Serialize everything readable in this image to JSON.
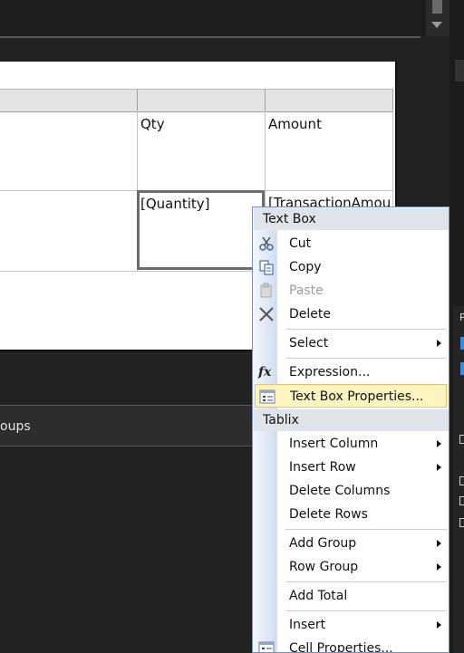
{
  "surface": {
    "header_qty": "Qty",
    "header_amount": "Amount",
    "cell_quantity": "[Quantity]",
    "cell_amount": "[TransactionAmou"
  },
  "groups_pane": {
    "label": "oups"
  },
  "right_panel": {
    "glyph_p": "P"
  },
  "context_menu": {
    "header_textbox": "Text Box",
    "header_tablix": "Tablix",
    "items": {
      "cut": "Cut",
      "copy": "Copy",
      "paste": "Paste",
      "delete": "Delete",
      "select": "Select",
      "expression": "Expression...",
      "textbox_properties": "Text Box Properties...",
      "insert_column": "Insert Column",
      "insert_row": "Insert Row",
      "delete_columns": "Delete Columns",
      "delete_rows": "Delete Rows",
      "add_group": "Add Group",
      "row_group": "Row Group",
      "add_total": "Add Total",
      "insert": "Insert",
      "cell_properties": "Cell Properties..."
    },
    "highlight_color": "#fdf4bf"
  }
}
